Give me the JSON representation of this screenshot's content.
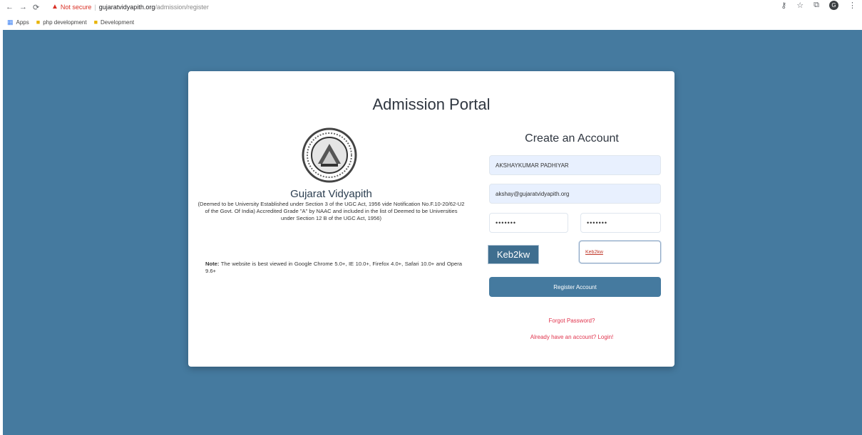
{
  "browser": {
    "not_secure": "Not secure",
    "separator": "|",
    "host": "gujaratvidyapith.org",
    "path": "/admission/register",
    "bookmarks": [
      {
        "label": "Apps"
      },
      {
        "label": "php development"
      },
      {
        "label": "Development"
      }
    ],
    "profile_initial": "G"
  },
  "card": {
    "title": "Admission Portal"
  },
  "university": {
    "name": "Gujarat Vidyapith",
    "description": "(Deemed to be University Established under Section 3 of the UGC Act, 1956 vide Notification No.F.10-20/62-U2 of the Govt. Of India) Accredited Grade \"A\" by NAAC and included in the list of Deemed to be Universities under Section 12 B of the UGC Act, 1956)",
    "note_label": "Note:",
    "note_text": " The website is best viewed in Google Chrome 5.0+, IE 10.0+, Firefox 4.0+, Safari 10.0+ and Opera 9.6+"
  },
  "form": {
    "title": "Create an Account",
    "name_value": "AKSHAYKUMAR PADHIYAR",
    "email_value": "akshay@gujaratvidyapith.org",
    "password_value": "•••••••",
    "confirm_password_value": "•••••••",
    "captcha_text": "Keb2kw",
    "captcha_input_value": "Keb2kw",
    "register_label": "Register Account",
    "forgot_label": "Forgot Password?",
    "login_label": "Already have an account? Login!"
  },
  "colors": {
    "page_bg": "#457a9f",
    "button": "#457a9f",
    "link": "#e0344d",
    "captcha_bg": "#3f6e8f"
  }
}
